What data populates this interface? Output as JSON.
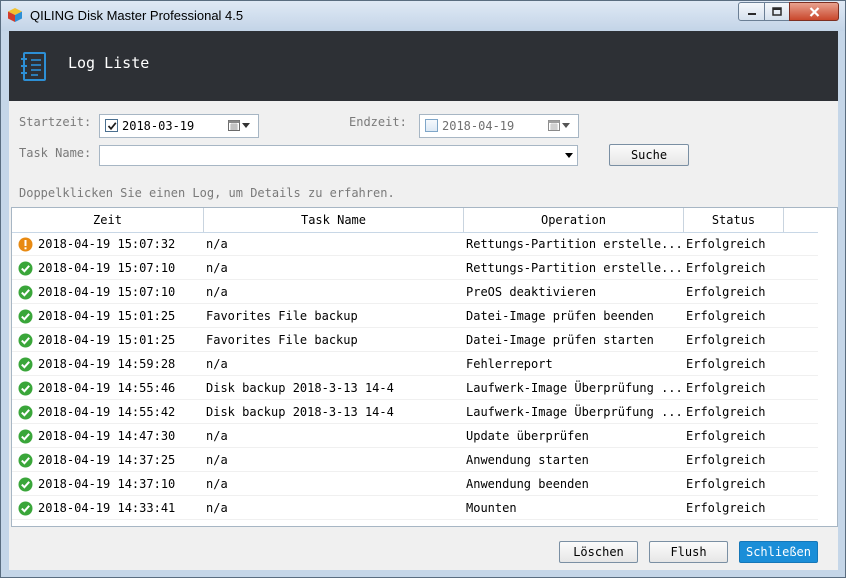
{
  "window": {
    "title": "QILING Disk Master Professional 4.5"
  },
  "header": {
    "title": "Log Liste"
  },
  "filters": {
    "start_label": "Startzeit:",
    "start_date": "2018-03-19",
    "start_checked": true,
    "end_label": "Endzeit:",
    "end_date": "2018-04-19",
    "end_checked": false,
    "task_label": "Task Name:",
    "task_value": "",
    "search_label": "Suche"
  },
  "hint": "Doppelklicken Sie einen Log, um Details zu erfahren.",
  "table": {
    "columns": [
      "Zeit",
      "Task Name",
      "Operation",
      "Status"
    ],
    "rows": [
      {
        "icon": "warning",
        "time": "2018-04-19 15:07:32",
        "task": "n/a",
        "operation": "Rettungs-Partition erstelle...",
        "status": "Erfolgreich"
      },
      {
        "icon": "success",
        "time": "2018-04-19 15:07:10",
        "task": "n/a",
        "operation": "Rettungs-Partition erstelle...",
        "status": "Erfolgreich"
      },
      {
        "icon": "success",
        "time": "2018-04-19 15:07:10",
        "task": "n/a",
        "operation": "PreOS deaktivieren",
        "status": "Erfolgreich"
      },
      {
        "icon": "success",
        "time": "2018-04-19 15:01:25",
        "task": "Favorites File backup",
        "operation": "Datei-Image prüfen beenden",
        "status": "Erfolgreich"
      },
      {
        "icon": "success",
        "time": "2018-04-19 15:01:25",
        "task": "Favorites File backup",
        "operation": "Datei-Image prüfen starten",
        "status": "Erfolgreich"
      },
      {
        "icon": "success",
        "time": "2018-04-19 14:59:28",
        "task": "n/a",
        "operation": "Fehlerreport",
        "status": "Erfolgreich"
      },
      {
        "icon": "success",
        "time": "2018-04-19 14:55:46",
        "task": "Disk backup 2018-3-13 14-4",
        "operation": "Laufwerk-Image Überprüfung ...",
        "status": "Erfolgreich"
      },
      {
        "icon": "success",
        "time": "2018-04-19 14:55:42",
        "task": "Disk backup 2018-3-13 14-4",
        "operation": "Laufwerk-Image Überprüfung ...",
        "status": "Erfolgreich"
      },
      {
        "icon": "success",
        "time": "2018-04-19 14:47:30",
        "task": "n/a",
        "operation": "Update überprüfen",
        "status": "Erfolgreich"
      },
      {
        "icon": "success",
        "time": "2018-04-19 14:37:25",
        "task": "n/a",
        "operation": "Anwendung starten",
        "status": "Erfolgreich"
      },
      {
        "icon": "success",
        "time": "2018-04-19 14:37:10",
        "task": "n/a",
        "operation": "Anwendung beenden",
        "status": "Erfolgreich"
      },
      {
        "icon": "success",
        "time": "2018-04-19 14:33:41",
        "task": "n/a",
        "operation": "Mounten",
        "status": "Erfolgreich"
      }
    ]
  },
  "footer": {
    "delete_label": "Löschen",
    "flush_label": "Flush",
    "close_label": "Schließen"
  },
  "colors": {
    "header_bg": "#2d3035",
    "accent": "#1a8ed8",
    "success": "#3aa63a",
    "warning": "#e88a12"
  }
}
